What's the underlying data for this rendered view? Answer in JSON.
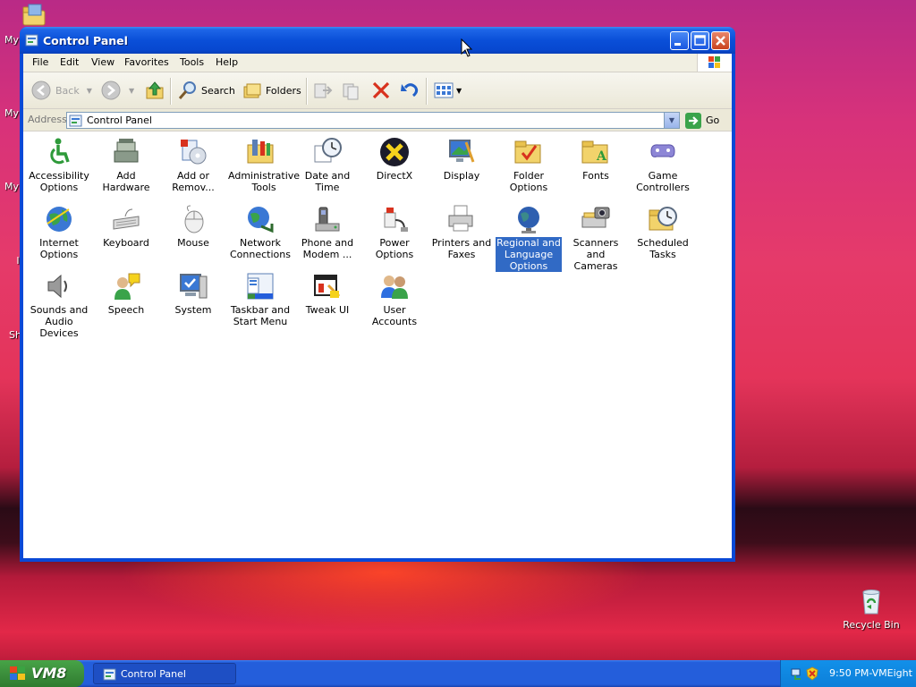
{
  "desktop": {
    "icons": [
      {
        "label": "My",
        "fragment": true
      },
      {
        "label": "My",
        "fragment": true
      },
      {
        "label": "My",
        "fragment": true
      },
      {
        "label": "I",
        "fragment": true
      },
      {
        "label": "Sh",
        "fragment": true
      }
    ],
    "recycle_bin": "Recycle Bin"
  },
  "window": {
    "title": "Control Panel",
    "buttons": {
      "minimize": "minimize-icon",
      "maximize": "maximize-icon",
      "close": "close-icon"
    }
  },
  "menubar": [
    "File",
    "Edit",
    "View",
    "Favorites",
    "Tools",
    "Help"
  ],
  "toolbar": {
    "back_label": "Back",
    "search_label": "Search",
    "folders_label": "Folders"
  },
  "address": {
    "label": "Address",
    "value": "Control Panel",
    "go_label": "Go"
  },
  "items": [
    {
      "label": "Accessibility Options",
      "icon": "accessibility-icon"
    },
    {
      "label": "Add Hardware",
      "icon": "add-hardware-icon"
    },
    {
      "label": "Add or Remov...",
      "icon": "add-remove-programs-icon"
    },
    {
      "label": "Administrative Tools",
      "icon": "administrative-tools-icon"
    },
    {
      "label": "Date and Time",
      "icon": "date-time-icon"
    },
    {
      "label": "DirectX",
      "icon": "directx-icon"
    },
    {
      "label": "Display",
      "icon": "display-icon"
    },
    {
      "label": "Folder Options",
      "icon": "folder-options-icon"
    },
    {
      "label": "Fonts",
      "icon": "fonts-icon"
    },
    {
      "label": "Game Controllers",
      "icon": "game-controllers-icon"
    },
    {
      "label": "Internet Options",
      "icon": "internet-options-icon"
    },
    {
      "label": "Keyboard",
      "icon": "keyboard-icon"
    },
    {
      "label": "Mouse",
      "icon": "mouse-icon"
    },
    {
      "label": "Network Connections",
      "icon": "network-connections-icon"
    },
    {
      "label": "Phone and Modem ...",
      "icon": "phone-modem-icon"
    },
    {
      "label": "Power Options",
      "icon": "power-options-icon"
    },
    {
      "label": "Printers and Faxes",
      "icon": "printers-faxes-icon"
    },
    {
      "label": "Regional and Language Options",
      "icon": "regional-language-icon",
      "selected": true
    },
    {
      "label": "Scanners and Cameras",
      "icon": "scanners-cameras-icon"
    },
    {
      "label": "Scheduled Tasks",
      "icon": "scheduled-tasks-icon"
    },
    {
      "label": "Sounds and Audio Devices",
      "icon": "sounds-audio-icon"
    },
    {
      "label": "Speech",
      "icon": "speech-icon"
    },
    {
      "label": "System",
      "icon": "system-icon"
    },
    {
      "label": "Taskbar and Start Menu",
      "icon": "taskbar-start-menu-icon"
    },
    {
      "label": "Tweak UI",
      "icon": "tweak-ui-icon"
    },
    {
      "label": "User Accounts",
      "icon": "user-accounts-icon"
    }
  ],
  "taskbar": {
    "start_label": "VM8",
    "task_label": "Control Panel",
    "clock": "9:50 PM-VMEight"
  },
  "colors": {
    "title_blue": "#0a4fd8",
    "selection": "#316ac5",
    "start_green": "#3c8f3c",
    "tray_blue": "#0d7fd9"
  }
}
